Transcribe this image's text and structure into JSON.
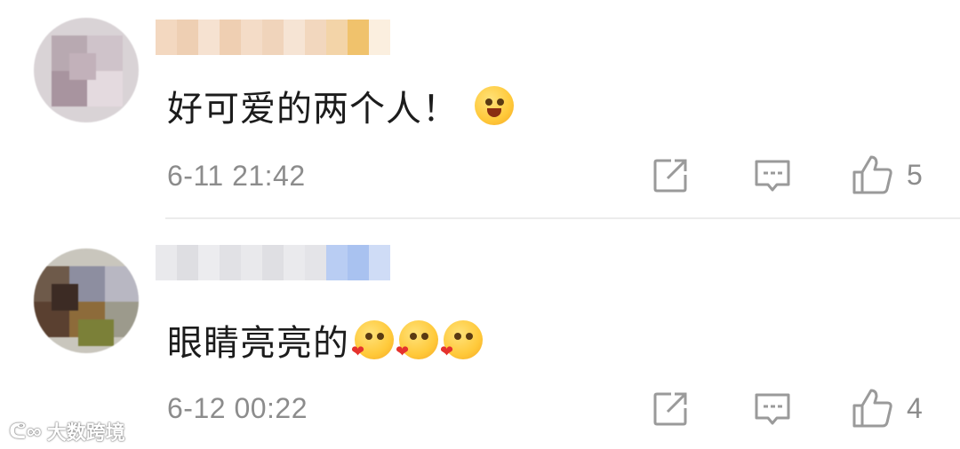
{
  "comments": [
    {
      "text": "好可爱的两个人！",
      "emoji": "grinning-face-emoji",
      "time": "6-11 21:42",
      "likes": "5"
    },
    {
      "text": "眼睛亮亮的",
      "emoji": "kissing-heart-face-emoji",
      "emoji_count": 3,
      "time": "6-12 00:22",
      "likes": "4"
    }
  ],
  "icons": {
    "share": "share-icon",
    "reply": "comment-icon",
    "like": "thumbs-up-icon"
  },
  "watermark": {
    "text": "大数跨境"
  },
  "colors": {
    "text": "#1c1c1c",
    "meta": "#8c8c8c",
    "divider": "#ececec",
    "emoji": "#ffc93a"
  }
}
